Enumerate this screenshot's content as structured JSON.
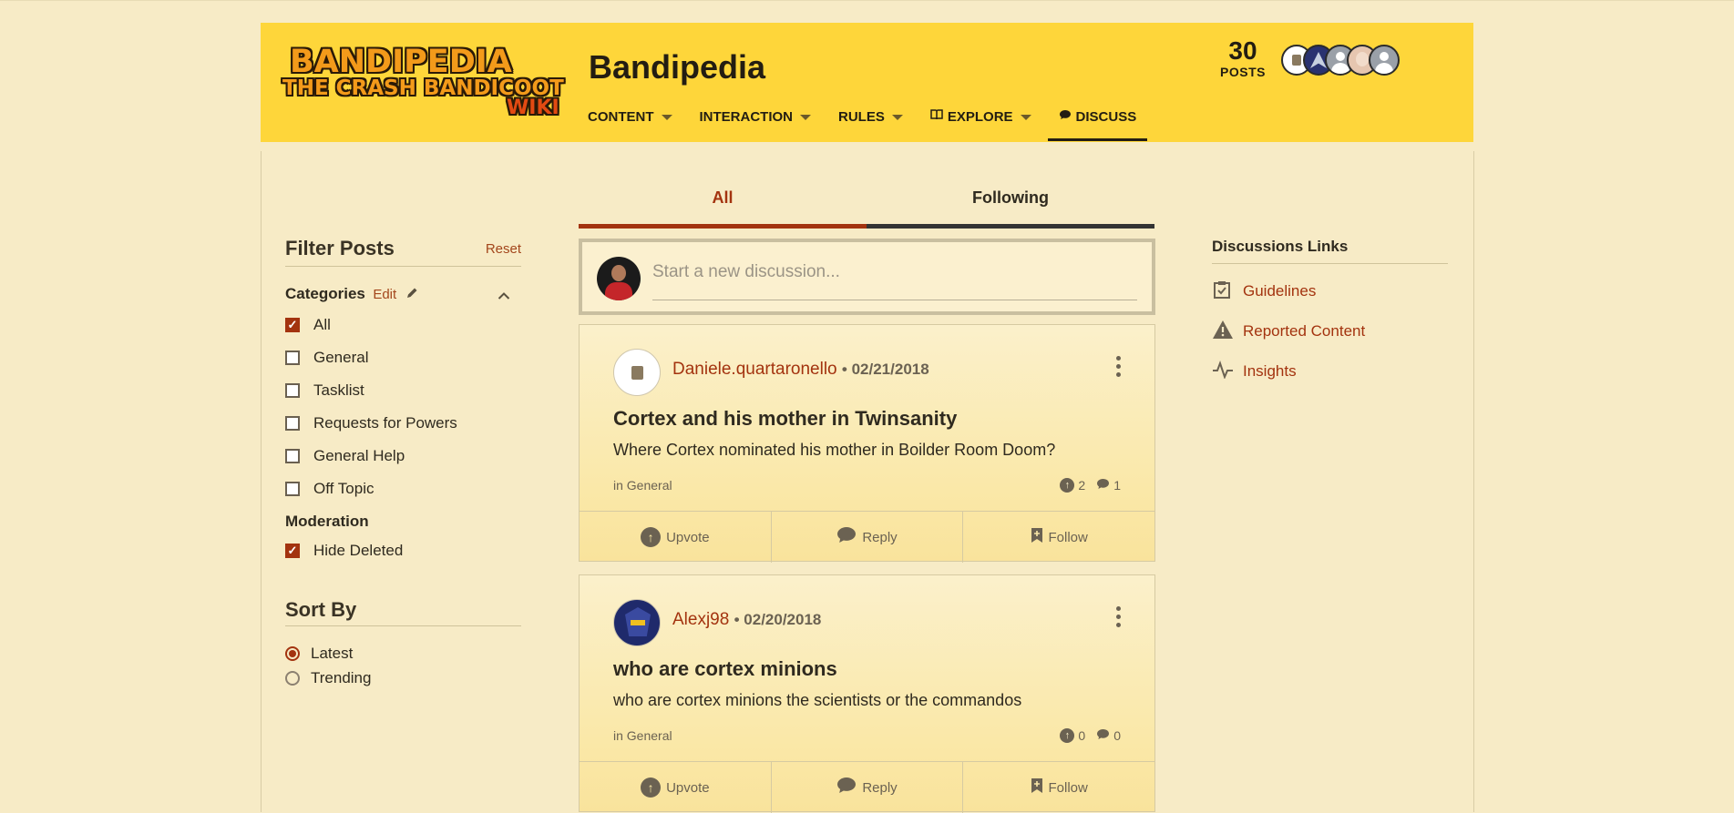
{
  "header": {
    "logo": {
      "line1": "BANDIPEDIA",
      "line2": "THE CRASH BANDICOOT",
      "line3": "WIKI"
    },
    "wiki_title": "Bandipedia",
    "nav": [
      {
        "label": "CONTENT",
        "icon": ""
      },
      {
        "label": "INTERACTION",
        "icon": ""
      },
      {
        "label": "RULES",
        "icon": ""
      },
      {
        "label": "EXPLORE",
        "icon": "book-icon"
      },
      {
        "label": "DISCUSS",
        "icon": "speech-bubble-icon"
      }
    ],
    "posts_count": "30",
    "posts_label": "POSTS"
  },
  "tabs": {
    "all": "All",
    "following": "Following"
  },
  "compose": {
    "placeholder": "Start a new discussion..."
  },
  "filter": {
    "title": "Filter Posts",
    "reset": "Reset",
    "categories_title": "Categories",
    "edit": "Edit",
    "categories": [
      {
        "label": "All",
        "checked": true
      },
      {
        "label": "General",
        "checked": false
      },
      {
        "label": "Tasklist",
        "checked": false
      },
      {
        "label": "Requests for Powers",
        "checked": false
      },
      {
        "label": "General Help",
        "checked": false
      },
      {
        "label": "Off Topic",
        "checked": false
      }
    ],
    "moderation_title": "Moderation",
    "hide_deleted": "Hide Deleted",
    "sort_title": "Sort By",
    "sort_options": [
      {
        "label": "Latest",
        "selected": true
      },
      {
        "label": "Trending",
        "selected": false
      }
    ]
  },
  "posts": [
    {
      "author": "Daniele.quartaronello",
      "date": "02/21/2018",
      "title": "Cortex and his mother in Twinsanity",
      "body": "Where Cortex nominated his mother in Boilder Room Doom?",
      "category_prefix": "in",
      "category": "General",
      "upvotes": "2",
      "replies": "1"
    },
    {
      "author": "Alexj98",
      "date": "02/20/2018",
      "title": "who are cortex minions",
      "body": "who are cortex minions the scientists or the commandos",
      "category_prefix": "in",
      "category": "General",
      "upvotes": "0",
      "replies": "0"
    }
  ],
  "actions": {
    "upvote": "Upvote",
    "reply": "Reply",
    "follow": "Follow"
  },
  "links": {
    "title": "Discussions Links",
    "items": [
      {
        "label": "Guidelines",
        "icon": "checklist-icon"
      },
      {
        "label": "Reported Content",
        "icon": "warning-icon"
      },
      {
        "label": "Insights",
        "icon": "pulse-icon"
      }
    ]
  },
  "colors": {
    "header_bg": "#fed63a",
    "page_bg": "#f7ebc6",
    "accent": "#a3330f"
  }
}
